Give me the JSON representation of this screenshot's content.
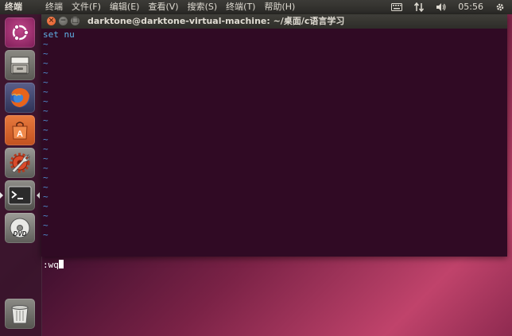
{
  "topbar": {
    "app_name": "终端",
    "menus": [
      "终端",
      "文件(F)",
      "编辑(E)",
      "查看(V)",
      "搜索(S)",
      "终端(T)",
      "帮助(H)"
    ],
    "time": "05:56"
  },
  "launcher": {
    "items": [
      {
        "name": "dash-home-button",
        "icon": "ubuntu-logo-icon"
      },
      {
        "name": "files-button",
        "icon": "file-cabinet-icon"
      },
      {
        "name": "firefox-button",
        "icon": "firefox-icon"
      },
      {
        "name": "software-center-button",
        "icon": "shopping-bag-icon"
      },
      {
        "name": "system-settings-button",
        "icon": "wrench-gear-icon"
      },
      {
        "name": "terminal-button",
        "icon": "terminal-icon",
        "active": true
      },
      {
        "name": "dvd-button",
        "icon": "dvd-icon"
      },
      {
        "name": "trash-button",
        "icon": "trash-icon"
      }
    ]
  },
  "terminal": {
    "title": "darktone@darktone-virtual-machine: ~/桌面/c语言学习",
    "first_line": "set nu",
    "tilde": "~",
    "tilde_count": 21,
    "command_line": ":wq"
  },
  "colors": {
    "terminal_bg": "#300a24",
    "command_text": "#5fb3e8",
    "tilde": "#4f8fd0",
    "close_button": "#e05a24"
  }
}
